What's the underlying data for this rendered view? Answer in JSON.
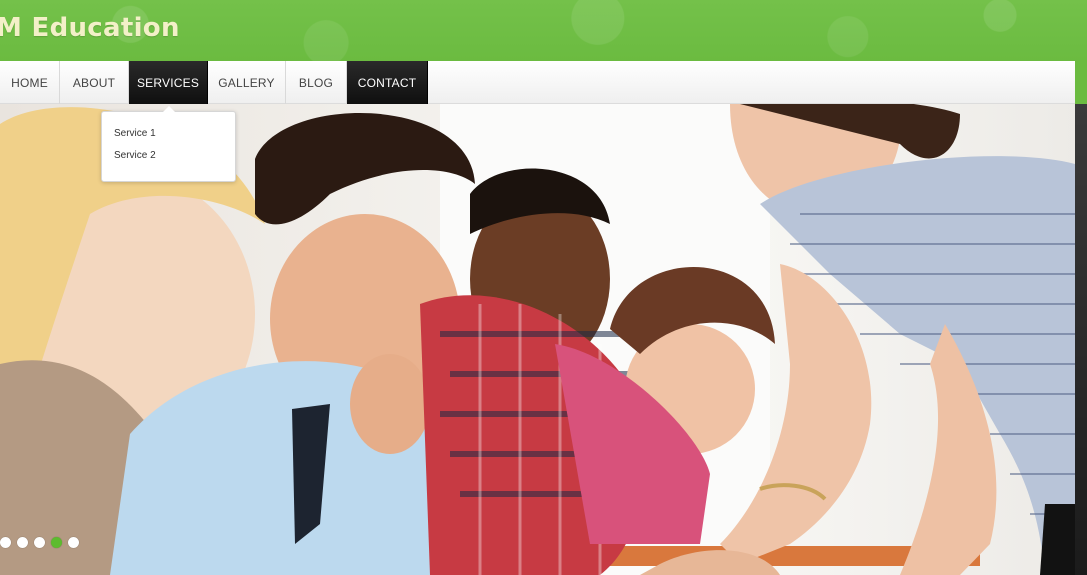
{
  "site": {
    "title": "M Education"
  },
  "nav": {
    "items": [
      {
        "label": "HOME",
        "active": false
      },
      {
        "label": "ABOUT",
        "active": false
      },
      {
        "label": "SERVICES",
        "active": true
      },
      {
        "label": "GALLERY",
        "active": false
      },
      {
        "label": "BLOG",
        "active": false
      },
      {
        "label": "CONTACT",
        "active": true
      }
    ]
  },
  "dropdown": {
    "items": [
      {
        "label": "Service 1"
      },
      {
        "label": "Service 2"
      }
    ]
  },
  "slider": {
    "dot_count": 5,
    "active_index": 3,
    "active_color": "#5dbb2f",
    "inactive_color": "#ffffff"
  },
  "colors": {
    "header_green": "#6bbb40",
    "title_color": "#f3f0c8",
    "nav_dark": "#111111"
  }
}
